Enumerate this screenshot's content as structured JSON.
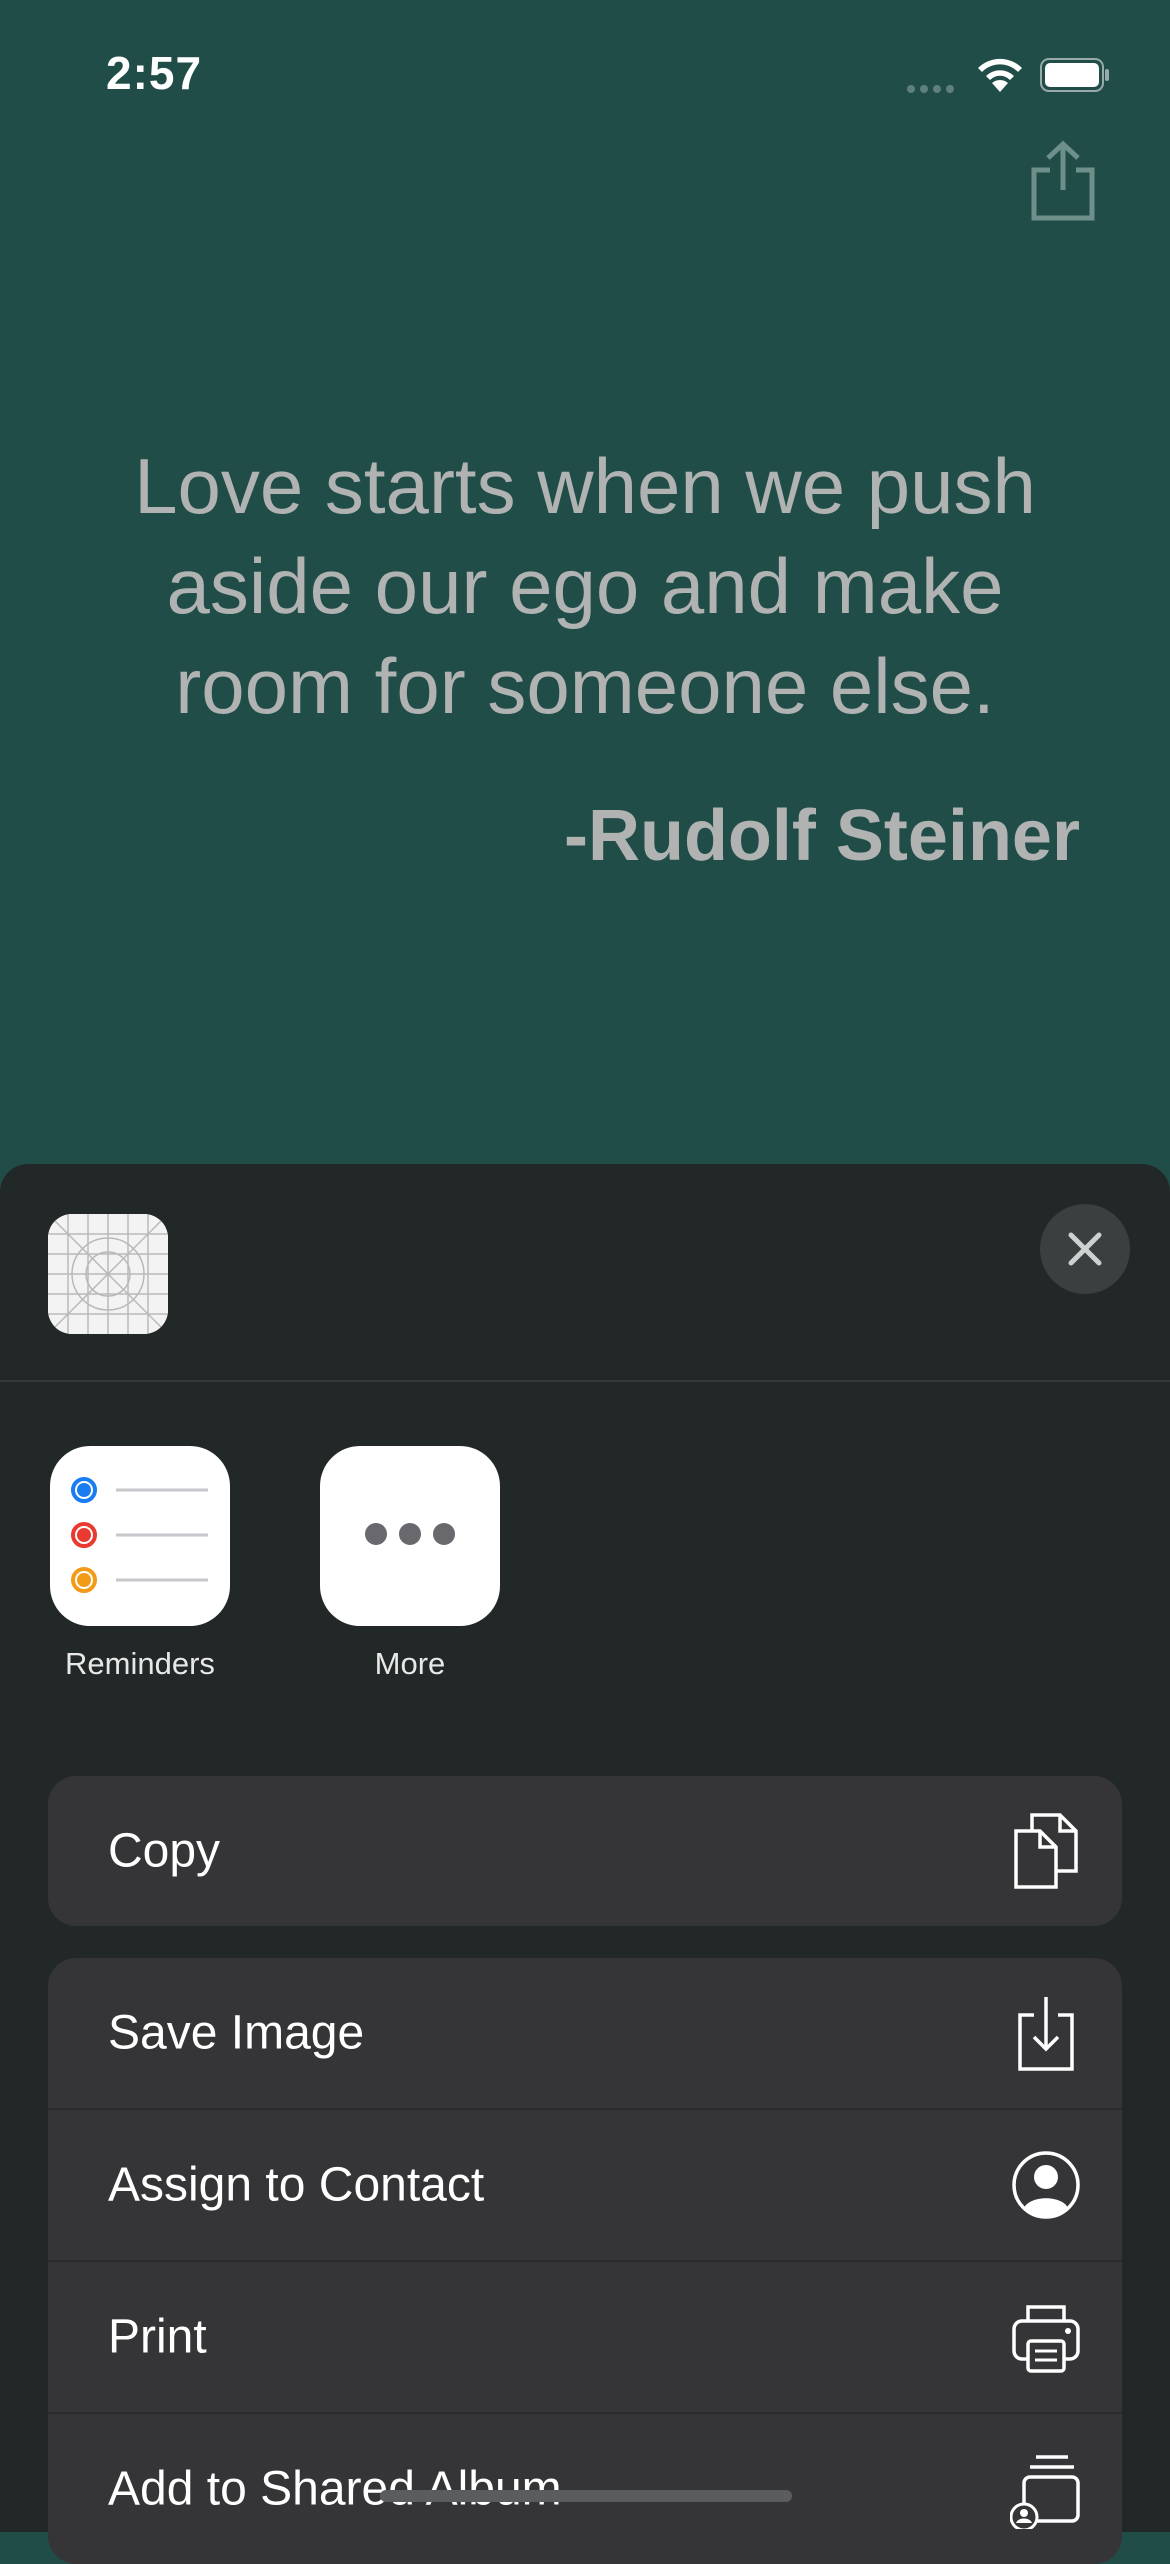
{
  "status_bar": {
    "time": "2:57"
  },
  "quote": {
    "text": "Love starts when we push aside our ego and make room for someone else.",
    "author": "-Rudolf Steiner"
  },
  "share_sheet": {
    "apps": [
      {
        "label": "Reminders",
        "icon": "reminders-icon"
      },
      {
        "label": "More",
        "icon": "more-icon"
      }
    ],
    "actions_group1": [
      {
        "label": "Copy",
        "icon": "copy-icon"
      }
    ],
    "actions_group2": [
      {
        "label": "Save Image",
        "icon": "save-image-icon"
      },
      {
        "label": "Assign to Contact",
        "icon": "contact-icon"
      },
      {
        "label": "Print",
        "icon": "print-icon"
      },
      {
        "label": "Add to Shared Album",
        "icon": "shared-album-icon"
      }
    ]
  },
  "colors": {
    "background": "#214d49",
    "sheet": "#222727",
    "row": "#353537",
    "quote_text": "#b0b3b2"
  }
}
